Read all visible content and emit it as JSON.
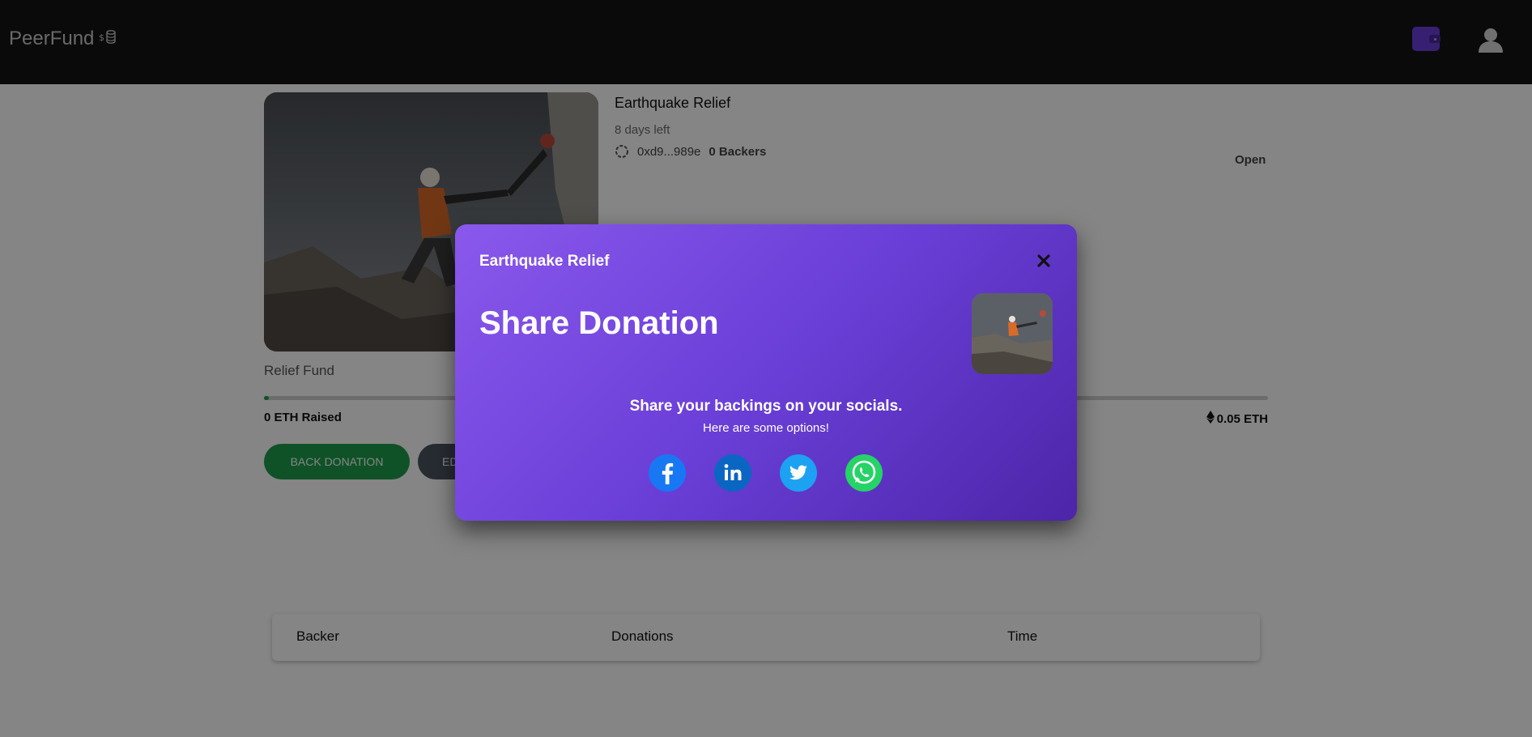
{
  "header": {
    "logo_text": "PeerFund",
    "logo_icon": "coins-icon",
    "wallet_icon": "wallet-icon",
    "user_icon": "user-icon",
    "accent_color": "#6a3fd8"
  },
  "campaign": {
    "title": "Earthquake Relief",
    "days_left": "8 days left",
    "owner_address": "0xd9...989e",
    "backers": "0 Backers",
    "status": "Open",
    "category": "Relief Fund",
    "progress_fraction": 0.005,
    "raised": "0 ETH Raised",
    "target": "0.05 ETH",
    "back_button": "BACK DONATION",
    "edit_button": "EDIT"
  },
  "table": {
    "headers": [
      "Backer",
      "Donations",
      "Time"
    ]
  },
  "modal": {
    "title": "Earthquake Relief",
    "heading": "Share Donation",
    "message": "Share your backings on your socials.",
    "sub_message": "Here are some options!",
    "socials": [
      "facebook-icon",
      "linkedin-icon",
      "twitter-icon",
      "whatsapp-icon"
    ]
  }
}
